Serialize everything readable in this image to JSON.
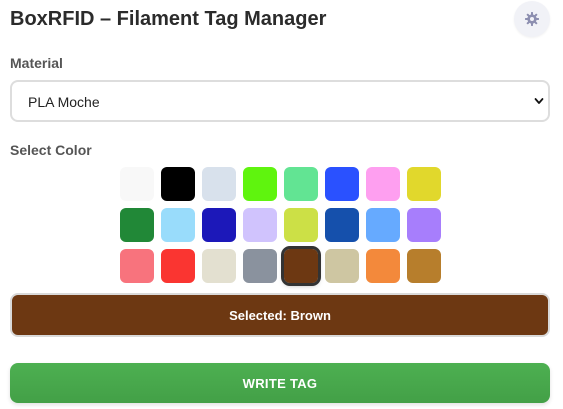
{
  "app": {
    "title": "BoxRFID – Filament Tag Manager",
    "settings_icon": "gear-icon"
  },
  "material": {
    "label": "Material",
    "selected": "PLA Moche",
    "dropdown_icon": "chevron-down-icon"
  },
  "color": {
    "label": "Select Color",
    "selected_index": 20,
    "swatches": [
      "#f8f8f8",
      "#000000",
      "#d8e1ec",
      "#5ff40e",
      "#62e493",
      "#2a51ff",
      "#fe9ff0",
      "#e1d82c",
      "#218837",
      "#99dcfb",
      "#1c18b9",
      "#d0c3fd",
      "#cce046",
      "#1550ac",
      "#66aaff",
      "#a77efc",
      "#f8737d",
      "#fa3531",
      "#e3e0d0",
      "#8a929e",
      "#6d3812",
      "#cec6a2",
      "#f3893b",
      "#b77e2c"
    ]
  },
  "selection": {
    "text": "Selected: Brown",
    "color": "#6d3812"
  },
  "write": {
    "label": "WRITE TAG"
  }
}
